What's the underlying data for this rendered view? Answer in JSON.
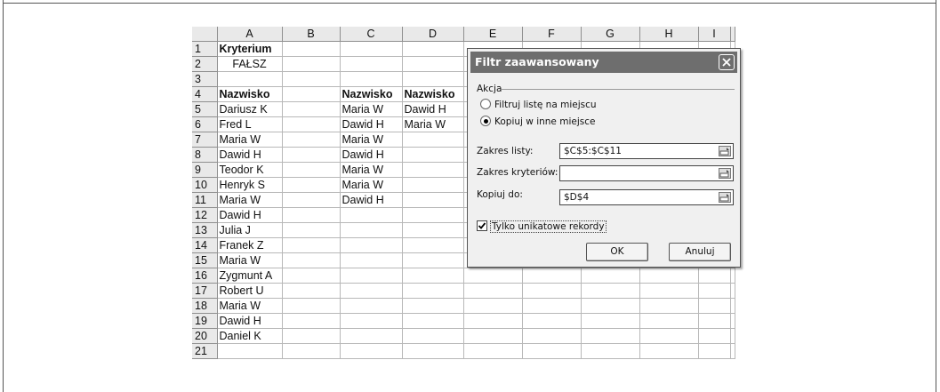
{
  "columns": [
    "A",
    "B",
    "C",
    "D",
    "E",
    "F",
    "G",
    "H",
    "I"
  ],
  "rows": [
    {
      "n": "1",
      "a": "Kryterium",
      "c": "",
      "d": ""
    },
    {
      "n": "2",
      "a": "FAŁSZ",
      "c": "",
      "d": ""
    },
    {
      "n": "3",
      "a": "",
      "c": "",
      "d": ""
    },
    {
      "n": "4",
      "a": "Nazwisko",
      "c": "Nazwisko",
      "d": "Nazwisko"
    },
    {
      "n": "5",
      "a": "Dariusz K",
      "c": "Maria W",
      "d": "Dawid H"
    },
    {
      "n": "6",
      "a": "Fred L",
      "c": "Dawid H",
      "d": "Maria W"
    },
    {
      "n": "7",
      "a": "Maria W",
      "c": "Maria W",
      "d": ""
    },
    {
      "n": "8",
      "a": "Dawid H",
      "c": "Dawid H",
      "d": ""
    },
    {
      "n": "9",
      "a": "Teodor K",
      "c": "Maria W",
      "d": ""
    },
    {
      "n": "10",
      "a": "Henryk S",
      "c": "Maria W",
      "d": ""
    },
    {
      "n": "11",
      "a": "Maria W",
      "c": "Dawid H",
      "d": ""
    },
    {
      "n": "12",
      "a": "Dawid H",
      "c": "",
      "d": ""
    },
    {
      "n": "13",
      "a": "Julia J",
      "c": "",
      "d": ""
    },
    {
      "n": "14",
      "a": "Franek Z",
      "c": "",
      "d": ""
    },
    {
      "n": "15",
      "a": "Maria W",
      "c": "",
      "d": ""
    },
    {
      "n": "16",
      "a": "Zygmunt A",
      "c": "",
      "d": ""
    },
    {
      "n": "17",
      "a": "Robert U",
      "c": "",
      "d": ""
    },
    {
      "n": "18",
      "a": "Maria W",
      "c": "",
      "d": ""
    },
    {
      "n": "19",
      "a": "Dawid H",
      "c": "",
      "d": ""
    },
    {
      "n": "20",
      "a": "Daniel K",
      "c": "",
      "d": ""
    },
    {
      "n": "21",
      "a": "",
      "c": "",
      "d": ""
    }
  ],
  "dialog": {
    "title": "Filtr zaawansowany",
    "action_label": "Akcja",
    "radio_filter_in_place": "Filtruj listę na miejscu",
    "radio_copy_elsewhere": "Kopiuj w inne miejsce",
    "list_range_label": "Zakres listy:",
    "list_range_value": "$C$5:$C$11",
    "criteria_range_label": "Zakres kryteriów:",
    "criteria_range_value": "",
    "copy_to_label": "Kopiuj do:",
    "copy_to_value": "$D$4",
    "unique_only_label": "Tylko unikatowe rekordy",
    "ok_label": "OK",
    "cancel_label": "Anuluj"
  }
}
